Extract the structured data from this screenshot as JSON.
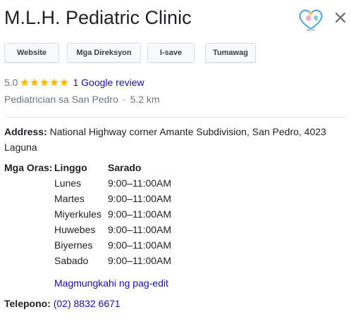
{
  "place": {
    "name": "M.L.H. Pediatric Clinic",
    "logo_text": "M.L.H"
  },
  "actions": [
    {
      "label": "Website"
    },
    {
      "label": "Mga Direksyon"
    },
    {
      "label": "I-save"
    },
    {
      "label": "Tumawag"
    }
  ],
  "rating": {
    "value": "5.0",
    "stars": 5,
    "review_link": "1 Google review",
    "star_color": "#fbbc04"
  },
  "category": {
    "type": "Pediatrician sa San Pedro",
    "separator": "·",
    "distance": "5.2 km"
  },
  "address": {
    "label": "Address:",
    "value": "National Highway corner Amante Subdivision, San Pedro, 4023 Laguna"
  },
  "hours": {
    "label": "Mga Oras:",
    "rows": [
      {
        "day": "Linggo",
        "time": "Sarado"
      },
      {
        "day": "Lunes",
        "time": "9:00–11:00AM"
      },
      {
        "day": "Martes",
        "time": "9:00–11:00AM"
      },
      {
        "day": "Miyerkules",
        "time": "9:00–11:00AM"
      },
      {
        "day": "Huwebes",
        "time": "9:00–11:00AM"
      },
      {
        "day": "Biyernes",
        "time": "9:00–11:00AM"
      },
      {
        "day": "Sabado",
        "time": "9:00–11:00AM"
      }
    ],
    "suggest_edit": "Magmungkahi ng pag-edit"
  },
  "phone": {
    "label": "Telepono:",
    "value": "(02) 8832 6671"
  },
  "colors": {
    "link": "#1a0dab",
    "secondary_text": "#70757a",
    "primary_text": "#202124"
  },
  "icons": {
    "close": "close-icon",
    "logo": "clinic-logo",
    "star": "star-icon"
  }
}
